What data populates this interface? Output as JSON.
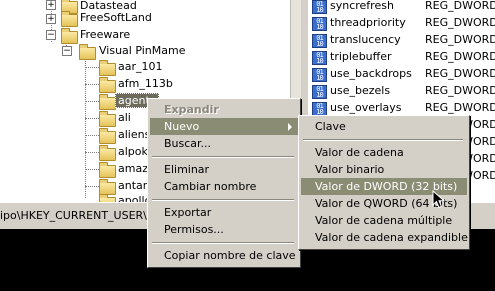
{
  "tree": {
    "items": [
      {
        "label": "Datastead"
      },
      {
        "label": "FreeSoftLand"
      },
      {
        "label": "Freeware"
      },
      {
        "label": "Visual PinMame"
      },
      {
        "label": "aar_101"
      },
      {
        "label": "afm_113b"
      },
      {
        "label": "agent"
      },
      {
        "label": "ali"
      },
      {
        "label": "aliens"
      },
      {
        "label": "alpok"
      },
      {
        "label": "amaze"
      },
      {
        "label": "antar"
      },
      {
        "label": "apollo"
      }
    ]
  },
  "values": {
    "rows": [
      {
        "name": "syncrefresh",
        "type": "REG_DWORD"
      },
      {
        "name": "threadpriority",
        "type": "REG_DWORD"
      },
      {
        "name": "translucency",
        "type": "REG_DWORD"
      },
      {
        "name": "triplebuffer",
        "type": "REG_DWORD"
      },
      {
        "name": "use_backdrops",
        "type": "REG_DWORD"
      },
      {
        "name": "use_bezels",
        "type": "REG_DWORD"
      },
      {
        "name": "use_overlays",
        "type": "REG_DWORD"
      },
      {
        "name": "",
        "type": "REG_DWORD"
      },
      {
        "name": "",
        "type": "REG_DWORD"
      },
      {
        "name": "",
        "type": "REG_DWORD"
      },
      {
        "name": "",
        "type": "REG_DWORD"
      }
    ],
    "reg_icon_text": "ab\n01"
  },
  "status": {
    "path": "ipo\\HKEY_CURRENT_USER\\"
  },
  "context_menu": {
    "expandir": "Expandir",
    "nuevo": "Nuevo",
    "buscar": "Buscar...",
    "eliminar": "Eliminar",
    "cambiar_nombre": "Cambiar nombre",
    "exportar": "Exportar",
    "permisos": "Permisos...",
    "copiar_nombre": "Copiar nombre de clave"
  },
  "submenu": {
    "clave": "Clave",
    "valor_cadena": "Valor de cadena",
    "valor_binario": "Valor binario",
    "valor_dword": "Valor de DWORD (32 bits)",
    "valor_qword": "Valor de QWORD (64 bits)",
    "valor_multiple": "Valor de cadena múltiple",
    "valor_expandible": "Valor de cadena expandible"
  },
  "colors": {
    "menu_highlight": "#8b8c74",
    "tree_selection": "#6d6b5c",
    "menu_face": "#d4d0c8"
  }
}
